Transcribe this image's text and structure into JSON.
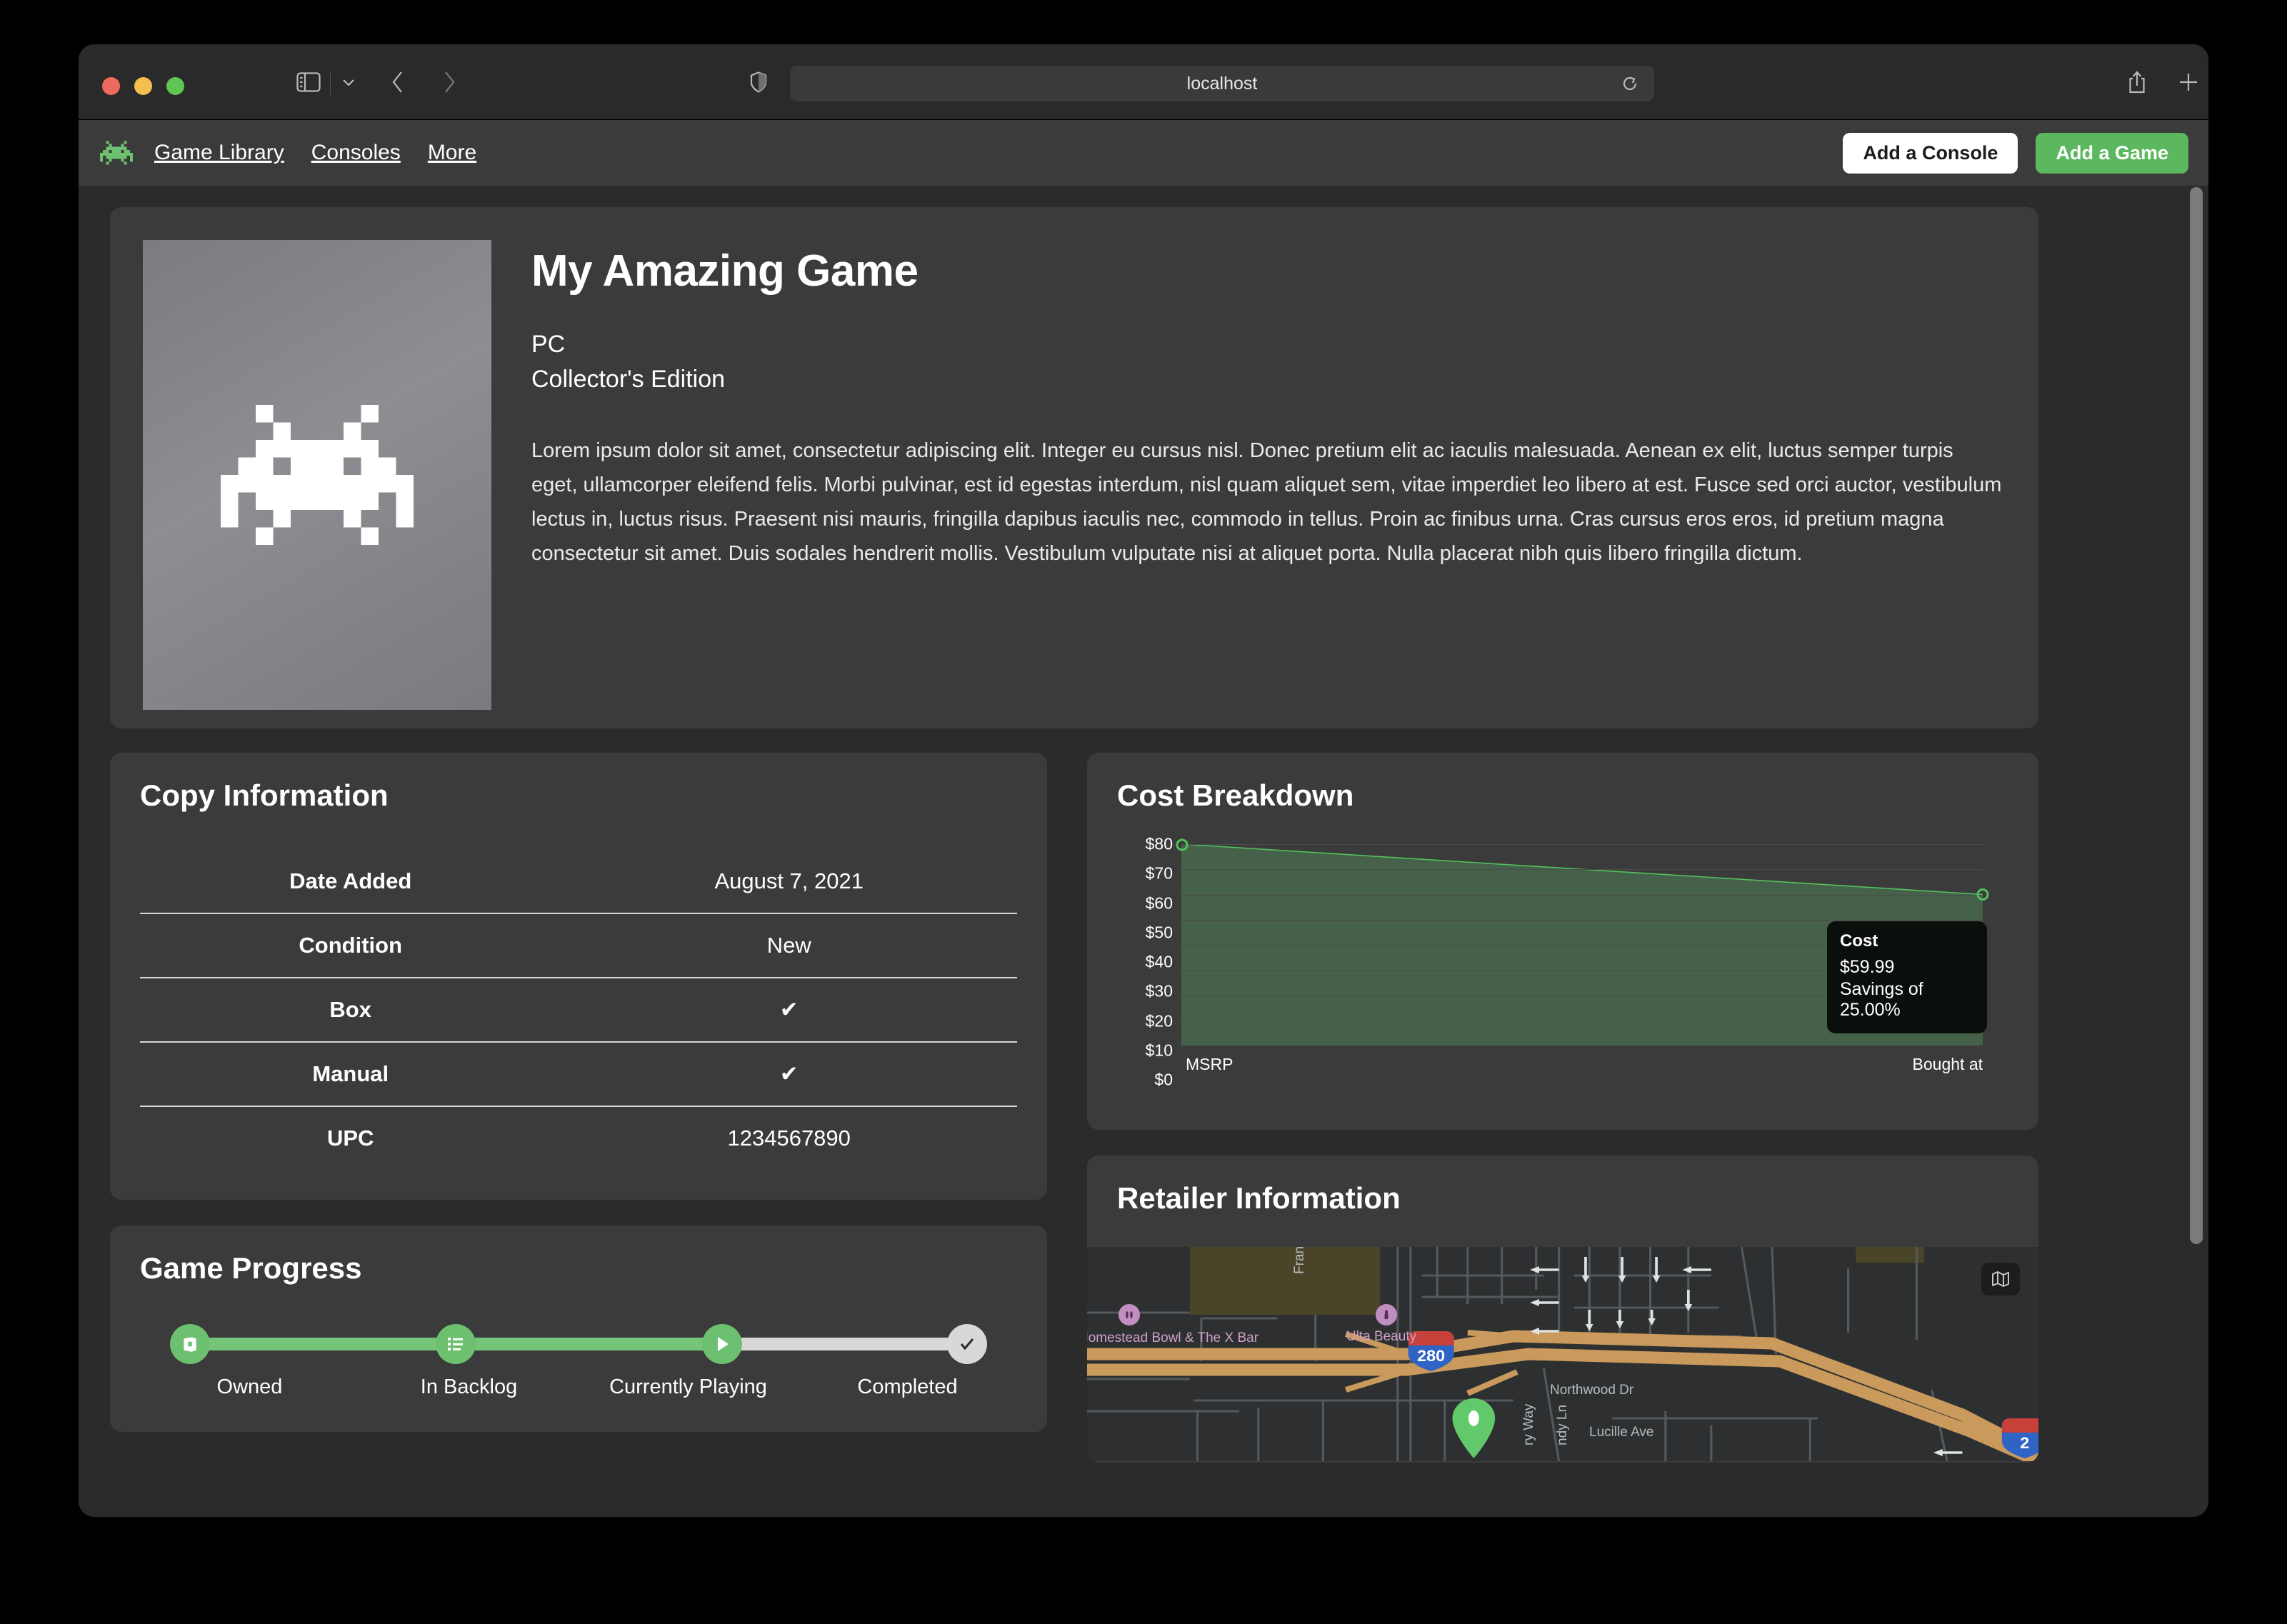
{
  "browser": {
    "url": "localhost",
    "icons": {
      "sidebar": "sidebar-icon",
      "sidebar_chevron": "chevron-down-icon",
      "back": "back-chevron-icon",
      "forward": "forward-chevron-icon",
      "shield": "shield-icon",
      "reload": "reload-icon",
      "share": "share-icon",
      "new_tab": "plus-icon",
      "tab_overview": "tab-overview-icon"
    }
  },
  "appnav": {
    "logo": "space-invader-logo",
    "links": [
      "Game Library",
      "Consoles",
      "More"
    ],
    "buttons": {
      "add_console": "Add a Console",
      "add_game": "Add a Game"
    }
  },
  "hero": {
    "cover_icon": "space-invader-cover-art",
    "title": "My Amazing Game",
    "platform": "PC",
    "edition": "Collector's Edition",
    "description": "Lorem ipsum dolor sit amet, consectetur adipiscing elit. Integer eu cursus nisl. Donec pretium elit ac iaculis malesuada. Aenean ex elit, luctus semper turpis eget, ullamcorper eleifend felis. Morbi pulvinar, est id egestas interdum, nisl quam aliquet sem, vitae imperdiet leo libero at est. Fusce sed orci auctor, vestibulum lectus in, luctus risus. Praesent nisi mauris, fringilla dapibus iaculis nec, commodo in tellus. Proin ac finibus urna. Cras cursus eros eros, id pretium magna consectetur sit amet. Duis sodales hendrerit mollis. Vestibulum vulputate nisi at aliquet porta. Nulla placerat nibh quis libero fringilla dictum."
  },
  "copy_information": {
    "title": "Copy Information",
    "rows": [
      {
        "key": "Date Added",
        "value": "August 7, 2021"
      },
      {
        "key": "Condition",
        "value": "New"
      },
      {
        "key": "Box",
        "value": "✔"
      },
      {
        "key": "Manual",
        "value": "✔"
      },
      {
        "key": "UPC",
        "value": "1234567890"
      }
    ]
  },
  "game_progress": {
    "title": "Game Progress",
    "steps": [
      {
        "label": "Owned",
        "icon": "box-icon",
        "state": "done"
      },
      {
        "label": "In Backlog",
        "icon": "list-icon",
        "state": "done"
      },
      {
        "label": "Currently Playing",
        "icon": "play-icon",
        "state": "done"
      },
      {
        "label": "Completed",
        "icon": "check-icon",
        "state": "todo"
      }
    ],
    "active_color": "#6cc070",
    "inactive_color": "#d8d8d8"
  },
  "cost_breakdown": {
    "title": "Cost Breakdown",
    "tooltip": {
      "title": "Cost",
      "value": "$59.99",
      "savings": "Savings of 25.00%"
    }
  },
  "chart_data": {
    "type": "area",
    "title": "Cost Breakdown",
    "categories": [
      "MSRP",
      "Bought at"
    ],
    "values": [
      79.99,
      59.99
    ],
    "series": [
      {
        "name": "Cost",
        "values": [
          79.99,
          59.99
        ]
      }
    ],
    "xlabel": "",
    "ylabel": "",
    "ylim": [
      0,
      80
    ],
    "yticks": [
      "$0",
      "$10",
      "$20",
      "$30",
      "$40",
      "$50",
      "$60",
      "$70",
      "$80"
    ],
    "ytick_values": [
      0,
      10,
      20,
      30,
      40,
      50,
      60,
      70,
      80
    ],
    "grid": true,
    "legend": "none",
    "line_color": "#53c15b",
    "fill_color": "#45614a",
    "annotations": [
      "Cost",
      "$59.99",
      "Savings of 25.00%"
    ]
  },
  "retailer_information": {
    "title": "Retailer Information",
    "map_button_icon": "map-icon",
    "map_labels": [
      {
        "text": "Homestead Bowl & The X Bar",
        "type": "poi"
      },
      {
        "text": "Ulta Beauty",
        "type": "poi"
      },
      {
        "text": "Franco",
        "type": "street"
      },
      {
        "text": "Northwood Dr",
        "type": "street"
      },
      {
        "text": "Lucille Ave",
        "type": "street"
      },
      {
        "text": "ry Way",
        "type": "street"
      },
      {
        "text": "ndy Ln",
        "type": "street"
      },
      {
        "text": "280",
        "type": "highway-shield"
      }
    ]
  }
}
